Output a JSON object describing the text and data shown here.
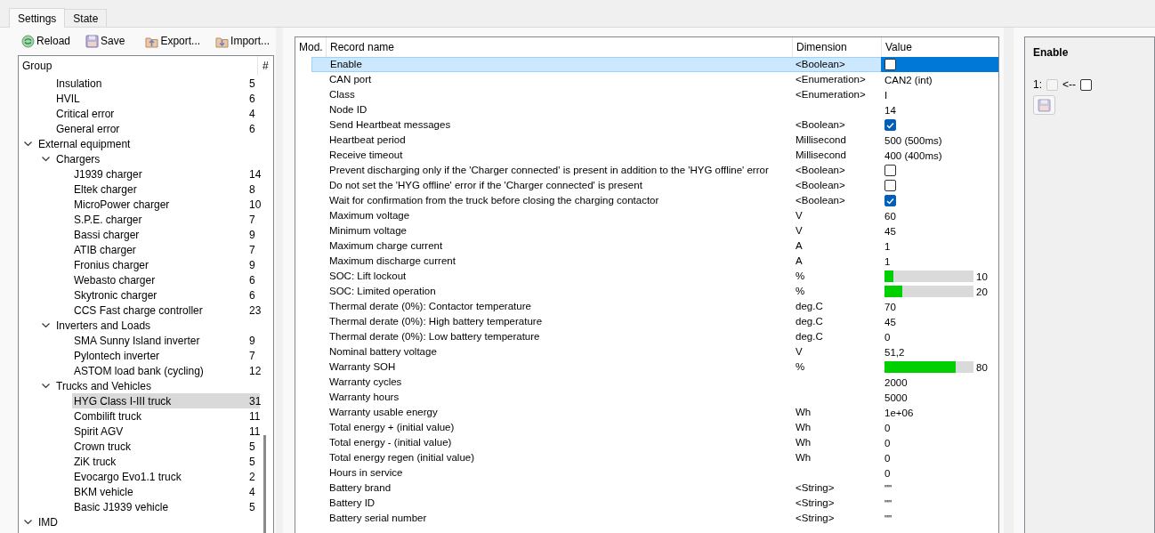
{
  "tabs": [
    {
      "label": "Settings",
      "selected": true
    },
    {
      "label": "State",
      "selected": false
    }
  ],
  "toolbar": [
    {
      "kind": "reload",
      "label": "Reload"
    },
    {
      "kind": "save",
      "label": "Save"
    },
    {
      "kind": "export",
      "label": "Export..."
    },
    {
      "kind": "import",
      "label": "Import..."
    }
  ],
  "tree": {
    "columns": [
      "Group",
      "#"
    ],
    "rows": [
      {
        "children": [
          {
            "label": "Insulation",
            "count": "5",
            "selected": false
          },
          {
            "label": "HVIL",
            "count": "6",
            "selected": false
          },
          {
            "label": "Critical error",
            "count": "4",
            "selected": false
          },
          {
            "label": "General error",
            "count": "6",
            "selected": false
          }
        ]
      },
      {
        "label": "External equipment",
        "expanded": true,
        "selected": false,
        "children": [
          {
            "label": "Chargers",
            "expanded": true,
            "selected": false,
            "children": [
              {
                "label": "J1939 charger",
                "count": "14",
                "selected": false
              },
              {
                "label": "Eltek charger",
                "count": "8",
                "selected": false
              },
              {
                "label": "MicroPower charger",
                "count": "10",
                "selected": false
              },
              {
                "label": "S.P.E. charger",
                "count": "7",
                "selected": false
              },
              {
                "label": "Bassi charger",
                "count": "9",
                "selected": false
              },
              {
                "label": "ATIB charger",
                "count": "7",
                "selected": false
              },
              {
                "label": "Fronius charger",
                "count": "9",
                "selected": false
              },
              {
                "label": "Webasto charger",
                "count": "6",
                "selected": false
              },
              {
                "label": "Skytronic charger",
                "count": "6",
                "selected": false
              },
              {
                "label": "CCS Fast charge controller",
                "count": "23",
                "selected": false
              }
            ]
          },
          {
            "label": "Inverters and Loads",
            "expanded": true,
            "selected": false,
            "children": [
              {
                "label": "SMA Sunny Island inverter",
                "count": "9",
                "selected": false
              },
              {
                "label": "Pylontech inverter",
                "count": "7",
                "selected": false
              },
              {
                "label": "ASTOM load bank (cycling)",
                "count": "12",
                "selected": false
              }
            ]
          },
          {
            "label": "Trucks and Vehicles",
            "expanded": true,
            "selected": false,
            "children": [
              {
                "label": "HYG Class I-III truck",
                "count": "31",
                "selected": true
              },
              {
                "label": "Combilift truck",
                "count": "11",
                "selected": false
              },
              {
                "label": "Spirit AGV",
                "count": "11",
                "selected": false
              },
              {
                "label": "Crown truck",
                "count": "5",
                "selected": false
              },
              {
                "label": "ZiK truck",
                "count": "5",
                "selected": false
              },
              {
                "label": "Evocargo Evo1.1 truck",
                "count": "2",
                "selected": false
              },
              {
                "label": "BKM vehicle",
                "count": "4",
                "selected": false
              },
              {
                "label": "Basic J1939 vehicle",
                "count": "5",
                "selected": false
              }
            ]
          }
        ]
      },
      {
        "label": "IMD",
        "expanded": true,
        "selected": false
      }
    ]
  },
  "table": {
    "columns": [
      "Mod.",
      "Record name",
      "Dimension",
      "Value"
    ],
    "rows": [
      {
        "name": "Enable",
        "dimension": "<Boolean>",
        "kind": "checkbox",
        "checked": false,
        "selected": true
      },
      {
        "name": "CAN port",
        "dimension": "<Enumeration>",
        "kind": "text",
        "value": "CAN2 (int)",
        "selected": false
      },
      {
        "name": "Class",
        "dimension": "<Enumeration>",
        "kind": "text",
        "value": "I",
        "selected": false
      },
      {
        "name": "Node ID",
        "kind": "text",
        "value": "14",
        "selected": false
      },
      {
        "name": "Send Heartbeat messages",
        "dimension": "<Boolean>",
        "kind": "checkbox",
        "checked": true,
        "selected": false
      },
      {
        "name": "Heartbeat period",
        "dimension": "Millisecond",
        "kind": "text",
        "value": "500 (500ms)",
        "selected": false
      },
      {
        "name": "Receive timeout",
        "dimension": "Millisecond",
        "kind": "text",
        "value": "400 (400ms)",
        "selected": false
      },
      {
        "name": "Prevent discharging only if the 'Charger connected' is present in addition to the 'HYG offline' error",
        "dimension": "<Boolean>",
        "kind": "checkbox",
        "checked": false,
        "selected": false
      },
      {
        "name": "Do not set the 'HYG offline' error if the 'Charger connected' is present",
        "dimension": "<Boolean>",
        "kind": "checkbox",
        "checked": false,
        "selected": false
      },
      {
        "name": "Wait for confirmation from the truck before closing the charging contactor",
        "dimension": "<Boolean>",
        "kind": "checkbox",
        "checked": true,
        "selected": false
      },
      {
        "name": "Maximum voltage",
        "dimension": "V",
        "kind": "text",
        "value": "60",
        "selected": false
      },
      {
        "name": "Minimum voltage",
        "dimension": "V",
        "kind": "text",
        "value": "45",
        "selected": false
      },
      {
        "name": "Maximum charge current",
        "dimension": "A",
        "kind": "text",
        "value": "1",
        "selected": false
      },
      {
        "name": "Maximum discharge current",
        "dimension": "A",
        "kind": "text",
        "value": "1",
        "selected": false
      },
      {
        "name": "SOC: Lift lockout",
        "dimension": "%",
        "kind": "bar",
        "level": 0.1,
        "value": "10",
        "selected": false
      },
      {
        "name": "SOC: Limited operation",
        "dimension": "%",
        "kind": "bar",
        "level": 0.2,
        "value": "20",
        "selected": false
      },
      {
        "name": "Thermal derate (0%): Contactor temperature",
        "dimension": "deg.C",
        "kind": "text",
        "value": "70",
        "selected": false
      },
      {
        "name": "Thermal derate (0%): High battery temperature",
        "dimension": "deg.C",
        "kind": "text",
        "value": "45",
        "selected": false
      },
      {
        "name": "Thermal derate (0%): Low battery temperature",
        "dimension": "deg.C",
        "kind": "text",
        "value": "0",
        "selected": false
      },
      {
        "name": "Nominal battery voltage",
        "dimension": "V",
        "kind": "text",
        "value": "51,2",
        "selected": false
      },
      {
        "name": "Warranty SOH",
        "dimension": "%",
        "kind": "bar",
        "level": 0.8,
        "value": "80",
        "selected": false
      },
      {
        "name": "Warranty cycles",
        "kind": "text",
        "value": "2000",
        "selected": false
      },
      {
        "name": "Warranty hours",
        "kind": "text",
        "value": "5000",
        "selected": false
      },
      {
        "name": "Warranty usable energy",
        "dimension": "Wh",
        "kind": "text",
        "value": "1e+06",
        "selected": false
      },
      {
        "name": "Total energy + (initial value)",
        "dimension": "Wh",
        "kind": "text",
        "value": "0",
        "selected": false
      },
      {
        "name": "Total energy - (initial value)",
        "dimension": "Wh",
        "kind": "text",
        "value": "0",
        "selected": false
      },
      {
        "name": "Total energy regen (initial value)",
        "dimension": "Wh",
        "kind": "text",
        "value": "0",
        "selected": false
      },
      {
        "name": "Hours in service",
        "kind": "text",
        "value": "0",
        "selected": false
      },
      {
        "name": "Battery brand",
        "dimension": "<String>",
        "kind": "text",
        "value": "\"\"",
        "selected": false
      },
      {
        "name": "Battery ID",
        "dimension": "<String>",
        "kind": "text",
        "value": "\"\"",
        "selected": false
      },
      {
        "name": "Battery serial number",
        "dimension": "<String>",
        "kind": "text",
        "value": "\"\"",
        "selected": false
      }
    ]
  },
  "editor": {
    "title": "Enable",
    "index_label": "1:",
    "current_checked": false,
    "current_disabled": true,
    "arrow": "<--",
    "new_checked": false,
    "save_disabled": true
  }
}
